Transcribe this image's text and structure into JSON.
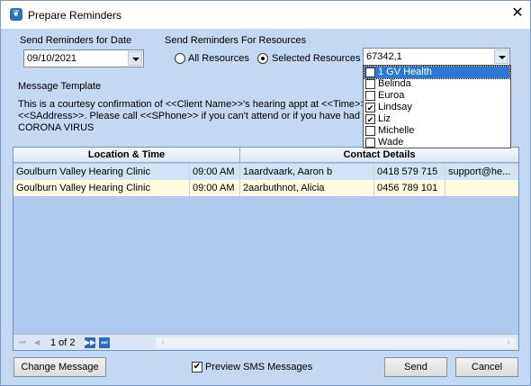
{
  "window": {
    "title": "Prepare Reminders"
  },
  "date_section": {
    "label": "Send Reminders for Date",
    "value": "09/10/2021"
  },
  "resources_section": {
    "label": "Send Reminders For Resources",
    "all_label": "All Resources",
    "selected_label": "Selected Resources",
    "selected_option": "selected",
    "combo_value": "67342,1"
  },
  "resources_dropdown": {
    "items": [
      {
        "label": "1 GV Health",
        "checked": false,
        "highlighted": true
      },
      {
        "label": "Belinda",
        "checked": false
      },
      {
        "label": "Euroa",
        "checked": false
      },
      {
        "label": "Lindsay",
        "checked": true
      },
      {
        "label": "Liz",
        "checked": true
      },
      {
        "label": "Michelle",
        "checked": false
      },
      {
        "label": "Wade",
        "checked": false
      }
    ]
  },
  "message_template": {
    "label": "Message Template",
    "lines": [
      "This is a courtesy confirmation of <<Client Name>>'s hearing appt at <<Time>>",
      "<<SAddress>>. Please call <<SPhone>> if you can't attend or if you have had",
      "CORONA VIRUS"
    ]
  },
  "grid": {
    "headers": [
      "Location & Time",
      "Contact Details"
    ],
    "rows": [
      [
        "Goulburn Valley Hearing Clinic",
        "09:00 AM",
        "1aardvaark, Aaron b",
        "0418 579 715",
        "support@he..."
      ],
      [
        "Goulburn Valley Hearing Clinic",
        "09:00 AM",
        "2aarbuthnot, Alicia",
        "0456 789 101",
        ""
      ]
    ],
    "pager": "1 of 2"
  },
  "footer": {
    "change_message": "Change Message",
    "preview_sms": "Preview SMS Messages",
    "preview_checked": true,
    "send": "Send",
    "cancel": "Cancel"
  },
  "colors": {
    "row_a": "#d3e3f6",
    "row_b": "#fefbe1",
    "highlight": "#2979d9"
  }
}
